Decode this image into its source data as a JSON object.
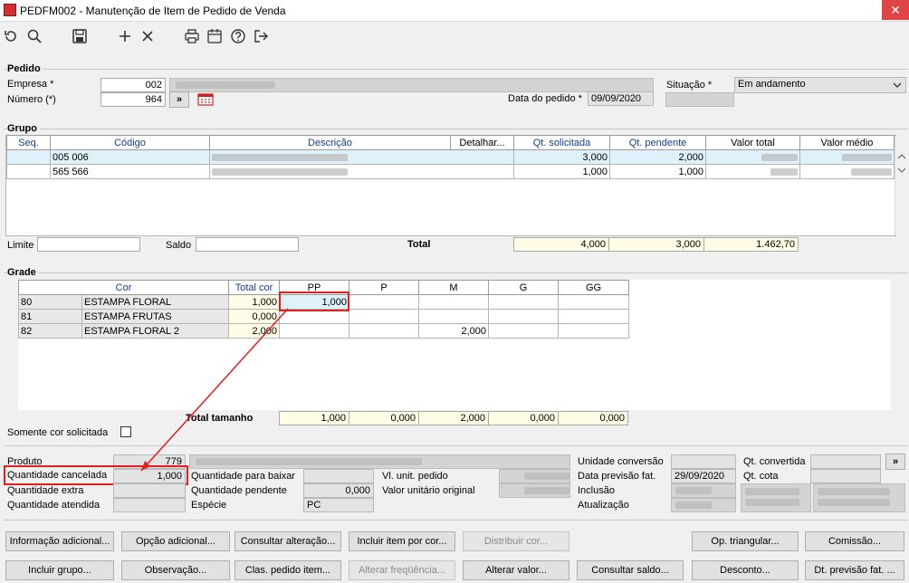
{
  "window": {
    "title": "PEDFM002 - Manutenção de Item de Pedido de Venda",
    "close_glyph": "✕"
  },
  "toolbar": {
    "icons": [
      "refresh-icon",
      "search-icon",
      "save-icon",
      "add-icon",
      "cancel-icon",
      "print-icon",
      "calendar-icon",
      "help-icon",
      "exit-icon"
    ]
  },
  "pedido": {
    "section": "Pedido",
    "empresa_label": "Empresa *",
    "empresa_value": "002",
    "numero_label": "Número (*)",
    "numero_value": "964",
    "go_label": "»",
    "data_pedido_label": "Data do pedido *",
    "data_pedido_value": "09/09/2020",
    "situacao_label": "Situação *",
    "situacao_value": "Em andamento"
  },
  "grupo": {
    "section": "Grupo",
    "columns": [
      "Seq.",
      "Código",
      "Descrição",
      "Detalhar...",
      "Qt. solicitada",
      "Qt. pendente",
      "Valor total",
      "Valor médio"
    ],
    "rows": [
      {
        "seq": "",
        "codigo": "005 006",
        "qt_solicitada": "3,000",
        "qt_pendente": "2,000"
      },
      {
        "seq": "",
        "codigo": "565 566",
        "qt_solicitada": "1,000",
        "qt_pendente": "1,000"
      }
    ],
    "limite_label": "Limite",
    "saldo_label": "Saldo",
    "total_label": "Total",
    "total_solicitada": "4,000",
    "total_pendente": "3,000",
    "total_valor": "1.462,70"
  },
  "grade": {
    "section": "Grade",
    "columns": [
      "Cor",
      "Total cor",
      "PP",
      "P",
      "M",
      "G",
      "GG"
    ],
    "rows": [
      {
        "code": "80",
        "cor": "ESTAMPA FLORAL",
        "total": "1,000",
        "pp": "1,000",
        "p": "",
        "m": "",
        "g": "",
        "gg": ""
      },
      {
        "code": "81",
        "cor": "ESTAMPA FRUTAS",
        "total": "0,000",
        "pp": "",
        "p": "",
        "m": "",
        "g": "",
        "gg": ""
      },
      {
        "code": "82",
        "cor": "ESTAMPA FLORAL 2",
        "total": "2,000",
        "pp": "",
        "p": "",
        "m": "2,000",
        "g": "",
        "gg": ""
      }
    ],
    "total_tamanho_label": "Total tamanho",
    "totals": {
      "pp": "1,000",
      "p": "0,000",
      "m": "2,000",
      "g": "0,000",
      "gg": "0,000"
    },
    "somente_cor_label": "Somente cor solicitada"
  },
  "detalhes": {
    "produto_label": "Produto",
    "produto_value": "779",
    "qtd_cancelada_label": "Quantidade cancelada",
    "qtd_cancelada_value": "1,000",
    "qtd_extra_label": "Quantidade extra",
    "qtd_atendida_label": "Quantidade atendida",
    "qtd_baixar_label": "Quantidade para baixar",
    "qtd_pendente_label": "Quantidade pendente",
    "qtd_pendente_value": "0,000",
    "especie_label": "Espécie",
    "especie_value": "PC",
    "vl_unit_label": "Vl. unit. pedido",
    "valor_unit_orig_label": "Valor unitário original",
    "unidade_conv_label": "Unidade conversão",
    "data_prev_label": "Data previsão fat.",
    "data_prev_value": "29/09/2020",
    "inclusao_label": "Inclusão",
    "atualizacao_label": "Atualização",
    "qt_convertida_label": "Qt. convertida",
    "qt_cota_label": "Qt. cota",
    "more_label": "»"
  },
  "buttons_row1": [
    {
      "label": "Informação adicional...",
      "disabled": false
    },
    {
      "label": "Opção adicional...",
      "disabled": false
    },
    {
      "label": "Consultar alteração...",
      "disabled": false
    },
    {
      "label": "Incluir item por cor...",
      "disabled": false
    },
    {
      "label": "Distribuir cor...",
      "disabled": true
    },
    {
      "label": "Op. triangular...",
      "disabled": false
    },
    {
      "label": "Comissão...",
      "disabled": false
    }
  ],
  "buttons_row2": [
    {
      "label": "Incluir grupo...",
      "disabled": false
    },
    {
      "label": "Observação...",
      "disabled": false
    },
    {
      "label": "Clas. pedido item...",
      "disabled": false
    },
    {
      "label": "Alterar freqüência...",
      "disabled": true
    },
    {
      "label": "Alterar valor...",
      "disabled": false
    },
    {
      "label": "Consultar saldo...",
      "disabled": false
    },
    {
      "label": "Desconto...",
      "disabled": false
    },
    {
      "label": "Dt. previsão fat. ...",
      "disabled": false
    }
  ],
  "colors": {
    "accent_blue": "#0d3d99",
    "highlight_red": "#e01f1f",
    "selected_row": "#dff1fb",
    "yellow_cell": "#fffce6"
  }
}
